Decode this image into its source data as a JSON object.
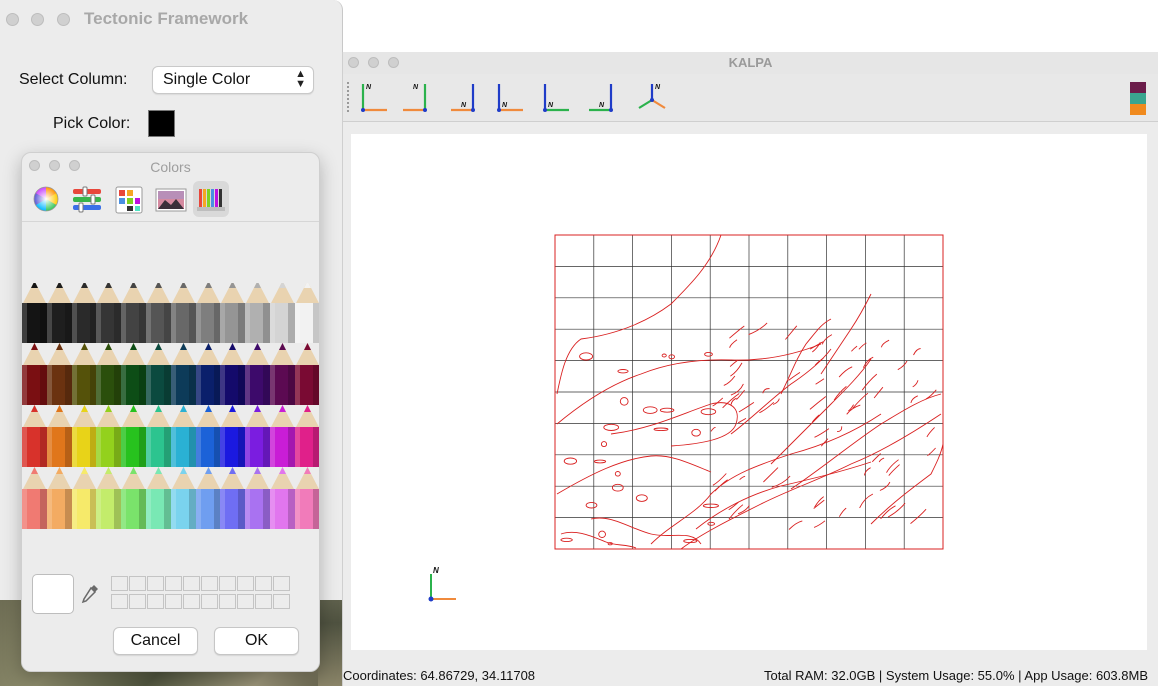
{
  "tectonic_window": {
    "title": "Tectonic Framework",
    "select_column_label": "Select Column:",
    "select_column_value": "Single Color",
    "pick_color_label": "Pick Color:",
    "picked_color": "#000000"
  },
  "colors_panel": {
    "title": "Colors",
    "modes": [
      {
        "name": "color-wheel-icon"
      },
      {
        "name": "color-sliders-icon"
      },
      {
        "name": "color-palettes-icon"
      },
      {
        "name": "image-palettes-icon"
      },
      {
        "name": "pencils-icon",
        "active": true
      }
    ],
    "pencil_rows": [
      [
        "#141414",
        "#1e1e1e",
        "#2a2a2a",
        "#353535",
        "#434343",
        "#555555",
        "#686868",
        "#7e7e7e",
        "#959595",
        "#b0b0b0",
        "#d4d4d4",
        "#f2f2f2"
      ],
      [
        "#7a0f12",
        "#6b3210",
        "#55520a",
        "#2b4f0c",
        "#0d4d16",
        "#0b4a3f",
        "#0d3b59",
        "#0a1f6b",
        "#140a6b",
        "#3d0a6b",
        "#5c0a52",
        "#7a0a33"
      ],
      [
        "#d8322b",
        "#e0761b",
        "#e8d318",
        "#93d11d",
        "#27c21e",
        "#2cc48f",
        "#2ab1d4",
        "#1c62d8",
        "#1b19e0",
        "#7b1de0",
        "#c91dd6",
        "#e0208a"
      ],
      [
        "#f07a72",
        "#f3ab62",
        "#f6ea6a",
        "#c3ec6b",
        "#7ae36b",
        "#79e8b4",
        "#7ad3ee",
        "#6f9ef0",
        "#6f6ef3",
        "#a972f1",
        "#e176ee",
        "#f17bba"
      ]
    ],
    "cancel_label": "Cancel",
    "ok_label": "OK"
  },
  "kalpa": {
    "title": "KALPA",
    "toolbar_tools": [
      "axis-view-1-icon",
      "axis-view-2-icon",
      "axis-view-3-icon",
      "axis-view-4-icon",
      "axis-view-5-icon",
      "axis-view-6-icon",
      "axis-view-3d-icon"
    ],
    "north_label": "N",
    "palette_colors": [
      "#6b1d4a",
      "#3aa58f",
      "#f08a1e"
    ],
    "map_grid": {
      "rows": 10,
      "cols": 10
    },
    "map_line_color": "#d92020",
    "status_coordinates": "Coordinates: 64.86729, 34.11708",
    "status_usage": "Total RAM: 32.0GB | System Usage: 55.0% | App Usage: 603.8MB"
  }
}
